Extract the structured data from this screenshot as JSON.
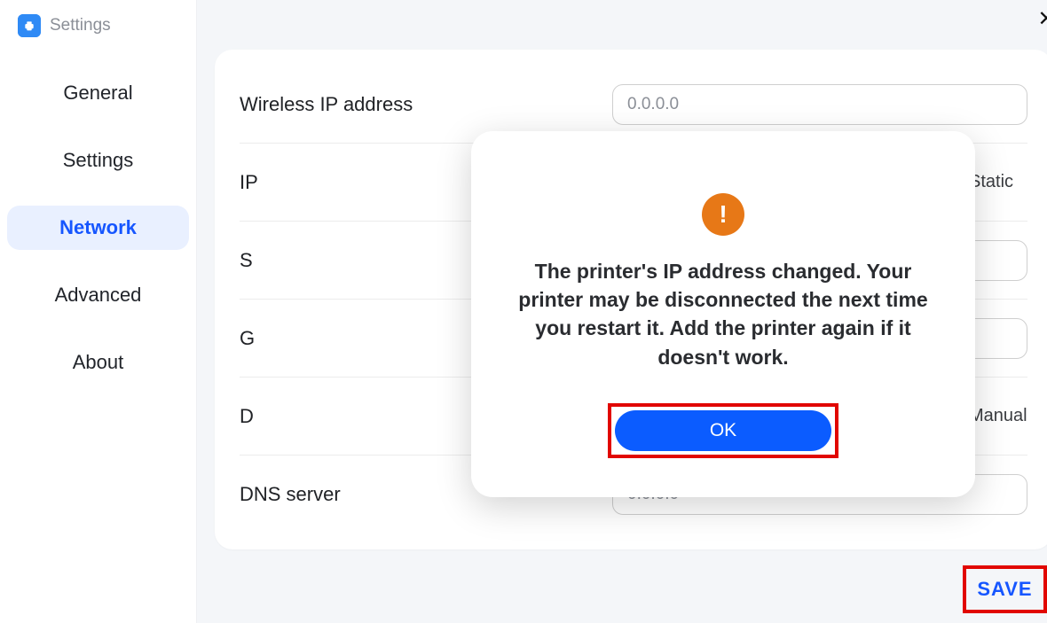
{
  "app": {
    "title": "Settings"
  },
  "sidebar": {
    "items": [
      {
        "label": "General",
        "active": false
      },
      {
        "label": "Settings",
        "active": false
      },
      {
        "label": "Network",
        "active": true
      },
      {
        "label": "Advanced",
        "active": false
      },
      {
        "label": "About",
        "active": false
      }
    ]
  },
  "form": {
    "wireless_ip": {
      "label": "Wireless IP address",
      "value": "0.0.0.0"
    },
    "ip_method": {
      "label": "IP",
      "options": [
        "Static"
      ],
      "selected": "Static"
    },
    "subnet": {
      "label": "S",
      "value": ""
    },
    "gateway": {
      "label": "G",
      "value": ""
    },
    "dns_method": {
      "label": "D",
      "options": [
        "Manual"
      ],
      "selected": "Manual"
    },
    "dns_server": {
      "label": "DNS server",
      "value": "0.0.0.0"
    }
  },
  "actions": {
    "save": "SAVE",
    "close": "✕"
  },
  "modal": {
    "icon": "!",
    "message": "The printer's IP address changed. Your printer may be disconnected the next time you restart it. Add the printer again if it doesn't work.",
    "ok": "OK"
  }
}
